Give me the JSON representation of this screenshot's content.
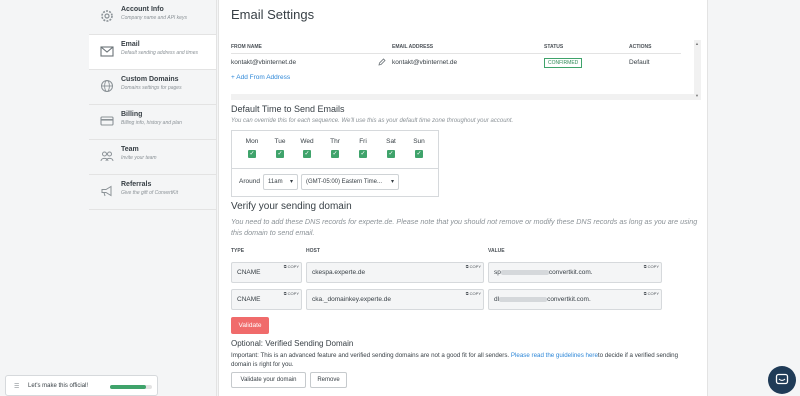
{
  "sidebar": {
    "items": [
      {
        "title": "Account Info",
        "sub": "Company name and API keys",
        "icon": "gear-icon"
      },
      {
        "title": "Email",
        "sub": "Default sending address and times",
        "icon": "envelope-icon"
      },
      {
        "title": "Custom Domains",
        "sub": "Domains settings for pages",
        "icon": "globe-icon"
      },
      {
        "title": "Billing",
        "sub": "Billing info, history and plan",
        "icon": "credit-card-icon"
      },
      {
        "title": "Team",
        "sub": "Invite your team",
        "icon": "team-icon"
      },
      {
        "title": "Referrals",
        "sub": "Give the gift of ConvertKit",
        "icon": "megaphone-icon"
      }
    ]
  },
  "main": {
    "title": "Email Settings",
    "emails_table": {
      "headers": [
        "FROM NAME",
        "EMAIL ADDRESS",
        "STATUS",
        "ACTIONS"
      ],
      "row": {
        "from_name": "kontakt@vbinternet.de",
        "email": "kontakt@vbinternet.de",
        "status": "CONFIRMED",
        "action": "Default"
      },
      "add_link": "+ Add From Address"
    },
    "default_time": {
      "title": "Default Time to Send Emails",
      "note": "You can override this for each sequence. We'll use this as your default time zone throughout your account.",
      "days": [
        "Mon",
        "Tue",
        "Wed",
        "Thr",
        "Fri",
        "Sat",
        "Sun"
      ],
      "around_label": "Around",
      "time_value": "11am",
      "timezone_value": "(GMT-05:00) Eastern Time..."
    },
    "verify": {
      "title": "Verify your sending domain",
      "note": "You need to add these DNS records for experte.de. Please note that you should not remove or modify these DNS records as long as you are using this domain to send email.",
      "headers": [
        "TYPE",
        "HOST",
        "VALUE"
      ],
      "copy_label": "COPY",
      "records": [
        {
          "type": "CNAME",
          "host": "ckespa.experte.de",
          "value_prefix": "sp",
          "value_suffix": "convertkit.com."
        },
        {
          "type": "CNAME",
          "host": "cka._domainkey.experte.de",
          "value_prefix": "dl",
          "value_suffix": "convertkit.com."
        }
      ],
      "validate_button": "Validate"
    },
    "optional": {
      "title": "Optional: Verified Sending Domain",
      "text_before": "Important: This is an advanced feature and verified sending domains are not a good fit for all senders. ",
      "link": "Please read the guidelines here",
      "text_after": "to decide if a verified sending domain is right for you.",
      "validate_domain_button": "Validate your domain",
      "remove_button": "Remove"
    }
  },
  "widget": {
    "label": "Let's make this official!",
    "progress": 0.85
  },
  "colors": {
    "accent_green": "#3fa36b",
    "link_blue": "#2f88d8",
    "validate_red": "#f06b6b",
    "chat_bg": "#1f3b57"
  }
}
